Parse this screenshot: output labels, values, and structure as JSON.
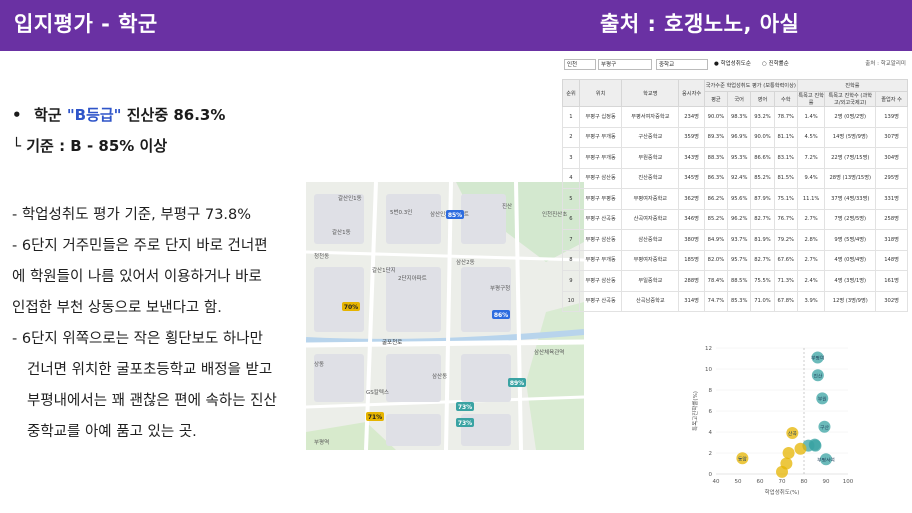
{
  "header": {
    "title": "입지평가 - 학군",
    "source": "출처 : 호갱노노, 아실"
  },
  "summary": {
    "bullet_mark": "•",
    "line1_prefix": "학군 ",
    "line1_grade": "\"B등급\"",
    "line1_suffix": " 진산중 86.3%",
    "line2": "└ 기준 : B - 85% 이상"
  },
  "notes": [
    "- 학업성취도 평가 기준, 부평구 73.8%",
    "- 6단지 거주민들은 주로 단지 바로 건너편",
    "에 학원들이 나름 있어서 이용하거나 바로",
    "인접한 부천 상동으로 보낸다고 함.",
    "-  6단지 위쪽으로는 작은 횡단보도 하나만",
    "건너면 위치한 굴포초등학교 배정을 받고",
    "부평내에서는 꽤 괜찮은 편에 속하는 진산",
    "중학교를 아예 품고 있는 곳."
  ],
  "map": {
    "road_label": "굴포천로",
    "labels": [
      "갈산인1동",
      "5번0.3인",
      "청천동",
      "갈산1동",
      "삼산2동",
      "부평구청",
      "상동",
      "삼산체육관역",
      "GS칼텍스",
      "부평역",
      "삼산인2동아파트",
      "갈산1단지",
      "2단지아파트",
      "진산",
      "인천진산초",
      "삼산동"
    ],
    "badges": [
      {
        "label": "85%",
        "color": "#2d6cdf"
      },
      {
        "label": "86%",
        "color": "#2d6cdf"
      },
      {
        "label": "70%",
        "color": "#e6b400"
      },
      {
        "label": "71%",
        "color": "#e6b400"
      },
      {
        "label": "73%",
        "color": "#3aa3a3"
      },
      {
        "label": "73%",
        "color": "#3aa3a3"
      },
      {
        "label": "89%",
        "color": "#3aa3a3"
      }
    ]
  },
  "table": {
    "filters": {
      "region": "인천",
      "district": "부평구",
      "level": "중학교",
      "radio1": "학업성취도순",
      "radio2": "진학률순",
      "source": "출처 : 학교알리미"
    },
    "group_headers": {
      "achievement": "국가수준 학업성취도 평가 (보통학력이상)",
      "advancement": "진학률"
    },
    "columns": [
      "순위",
      "위치",
      "학교명",
      "응시자수",
      "평균",
      "국어",
      "영어",
      "수학",
      "특목고 진학률",
      "특목고 진학수 (과학고/외고국제고)",
      "졸업자 수"
    ],
    "rows": [
      [
        "1",
        "부평구 십정동",
        "부평서여자중학교",
        "234명",
        "90.0%",
        "98.3%",
        "93.2%",
        "78.7%",
        "1.4%",
        "2명 (0명/2명)",
        "139명"
      ],
      [
        "2",
        "부평구 부개동",
        "구산중학교",
        "359명",
        "89.3%",
        "96.9%",
        "90.0%",
        "81.1%",
        "4.5%",
        "14명 (5명/9명)",
        "307명"
      ],
      [
        "3",
        "부평구 부개동",
        "부원중학교",
        "343명",
        "88.3%",
        "95.3%",
        "86.6%",
        "83.1%",
        "7.2%",
        "22명 (7명/15명)",
        "304명"
      ],
      [
        "4",
        "부평구 삼산동",
        "진산중학교",
        "345명",
        "86.3%",
        "92.4%",
        "85.2%",
        "81.5%",
        "9.4%",
        "28명 (13명/15명)",
        "295명"
      ],
      [
        "5",
        "부평구 부평동",
        "부평여자중학교",
        "362명",
        "86.2%",
        "95.6%",
        "87.9%",
        "75.1%",
        "11.1%",
        "37명 (4명/33명)",
        "331명"
      ],
      [
        "6",
        "부평구 산곡동",
        "산곡여자중학교",
        "346명",
        "85.2%",
        "96.2%",
        "82.7%",
        "76.7%",
        "2.7%",
        "7명 (2명/5명)",
        "258명"
      ],
      [
        "7",
        "부평구 삼산동",
        "삼산중학교",
        "380명",
        "84.9%",
        "93.7%",
        "81.9%",
        "79.2%",
        "2.8%",
        "9명 (5명/4명)",
        "318명"
      ],
      [
        "8",
        "부평구 부개동",
        "부평여자중학교",
        "185명",
        "82.0%",
        "95.7%",
        "82.7%",
        "67.6%",
        "2.7%",
        "4명 (0명/4명)",
        "148명"
      ],
      [
        "9",
        "부평구 삼산동",
        "부일중학교",
        "288명",
        "78.4%",
        "88.5%",
        "75.5%",
        "71.3%",
        "2.4%",
        "4명 (3명/1명)",
        "161명"
      ],
      [
        "10",
        "부평구 산곡동",
        "산곡남중학교",
        "314명",
        "74.7%",
        "85.3%",
        "71.0%",
        "67.8%",
        "3.9%",
        "12명 (3명/9명)",
        "302명"
      ]
    ]
  },
  "chart_data": {
    "type": "scatter",
    "xlabel": "학업성취도(%)",
    "ylabel": "특목고진학률(%)",
    "xlim": [
      40,
      100
    ],
    "ylim": [
      0,
      12
    ],
    "xticks": [
      "40",
      "50",
      "60",
      "70",
      "80",
      "90",
      "100"
    ],
    "yticks": [
      "0",
      "2",
      "4",
      "6",
      "8",
      "10",
      "12"
    ],
    "points": [
      {
        "x": 86.2,
        "y": 11.1,
        "label": "부평여",
        "color": "#3aa3a3"
      },
      {
        "x": 86.3,
        "y": 9.4,
        "label": "진산",
        "color": "#3aa3a3"
      },
      {
        "x": 88.3,
        "y": 7.2,
        "label": "부원",
        "color": "#3aa3a3"
      },
      {
        "x": 89.3,
        "y": 4.5,
        "label": "구산",
        "color": "#3aa3a3"
      },
      {
        "x": 90.0,
        "y": 1.4,
        "label": "부평서여",
        "color": "#3aa3a3"
      },
      {
        "x": 85.2,
        "y": 2.7,
        "label": "",
        "color": "#3aa3a3"
      },
      {
        "x": 84.9,
        "y": 2.8,
        "label": "",
        "color": "#3aa3a3"
      },
      {
        "x": 82.0,
        "y": 2.7,
        "label": "",
        "color": "#3aa3a3"
      },
      {
        "x": 78.4,
        "y": 2.4,
        "label": "",
        "color": "#e6b400"
      },
      {
        "x": 74.7,
        "y": 3.9,
        "label": "산곡",
        "color": "#e6b400"
      },
      {
        "x": 73.0,
        "y": 2.0,
        "label": "",
        "color": "#e6b400"
      },
      {
        "x": 72.0,
        "y": 1.0,
        "label": "",
        "color": "#e6b400"
      },
      {
        "x": 70.0,
        "y": 0.2,
        "label": "",
        "color": "#e6b400"
      },
      {
        "x": 52.0,
        "y": 1.5,
        "label": "동암",
        "color": "#e6b400"
      }
    ]
  }
}
